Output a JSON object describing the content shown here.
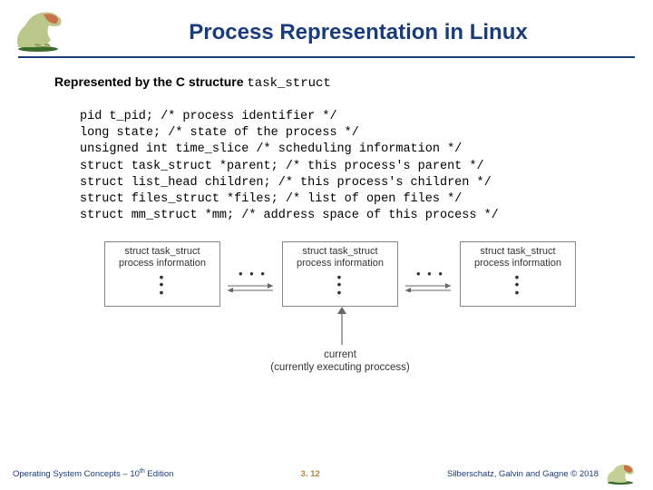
{
  "header": {
    "title": "Process Representation in Linux"
  },
  "body": {
    "intro_prefix": "Represented by the C structure ",
    "intro_code": "task_struct",
    "code": "pid t_pid; /* process identifier */\nlong state; /* state of the process */\nunsigned int time_slice /* scheduling information */\nstruct task_struct *parent; /* this process's parent */\nstruct list_head children; /* this process's children */\nstruct files_struct *files; /* list of open files */\nstruct mm_struct *mm; /* address space of this process */"
  },
  "diagram": {
    "box_line1": "struct task_struct",
    "box_line2": "process information",
    "ellipsis": "• • •",
    "caption_line1": "current",
    "caption_line2": "(currently executing proccess)"
  },
  "footer": {
    "left_prefix": "Operating System Concepts – 10",
    "left_sup": "th",
    "left_suffix": " Edition",
    "center": "3. 12",
    "right": "Silberschatz, Galvin and Gagne © 2018"
  }
}
